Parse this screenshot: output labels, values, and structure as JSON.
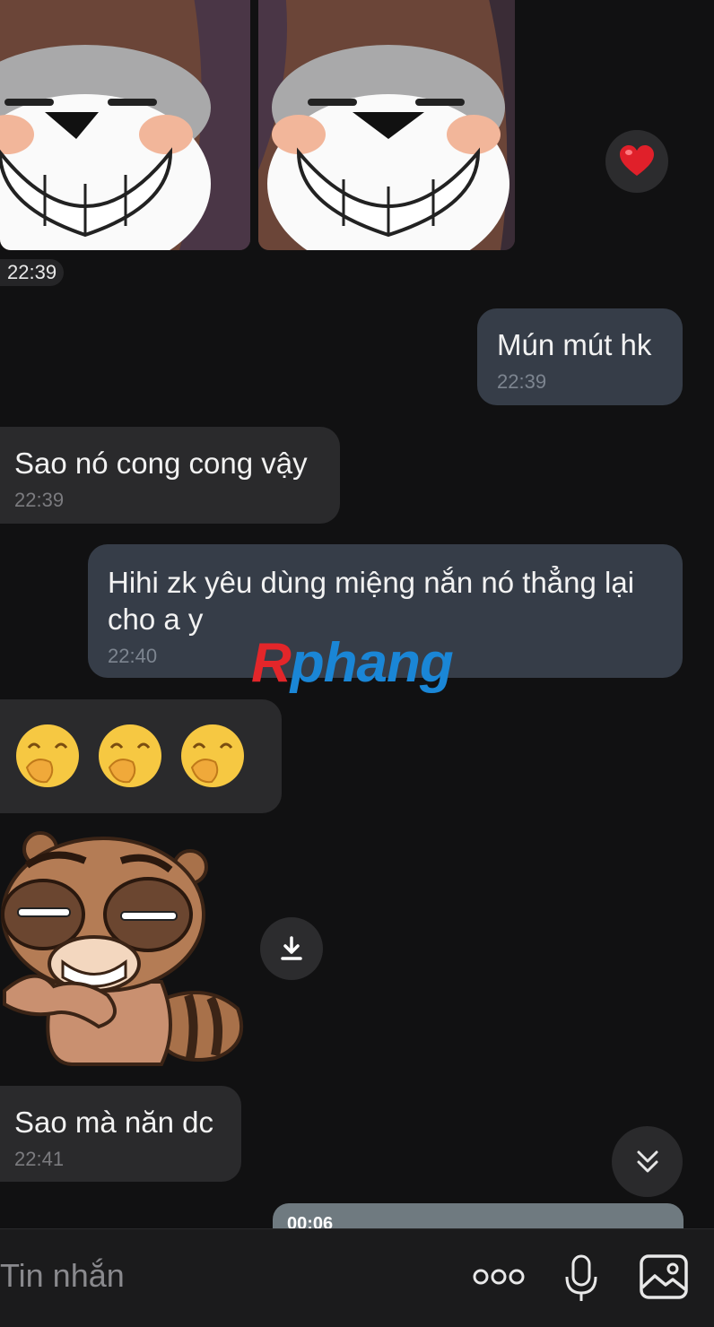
{
  "messages": {
    "photo_time": "22:39",
    "m1": {
      "text": "Mún mút hk",
      "time": "22:39"
    },
    "m2": {
      "text": "Sao nó cong cong vậy",
      "time": "22:39"
    },
    "m3": {
      "text": "Hihi zk yêu dùng miệng nắn nó thẳng lại cho a y",
      "time": "22:40"
    },
    "m5": {
      "text": "Sao mà năn dc",
      "time": "22:41"
    },
    "video_duration": "00:06"
  },
  "watermark": {
    "r": "R",
    "rest": "phang"
  },
  "composer": {
    "placeholder": "Tin nhắn"
  },
  "icons": {
    "reaction": "heart-icon",
    "download": "download-icon",
    "scroll": "chevron-double-down-icon",
    "more": "more-icon",
    "mic": "microphone-icon",
    "gallery": "image-icon",
    "emoji": "hand-over-mouth-emoji"
  },
  "colors": {
    "background": "#111112",
    "incoming": "#2a2a2c",
    "outgoing": "#363d48"
  }
}
